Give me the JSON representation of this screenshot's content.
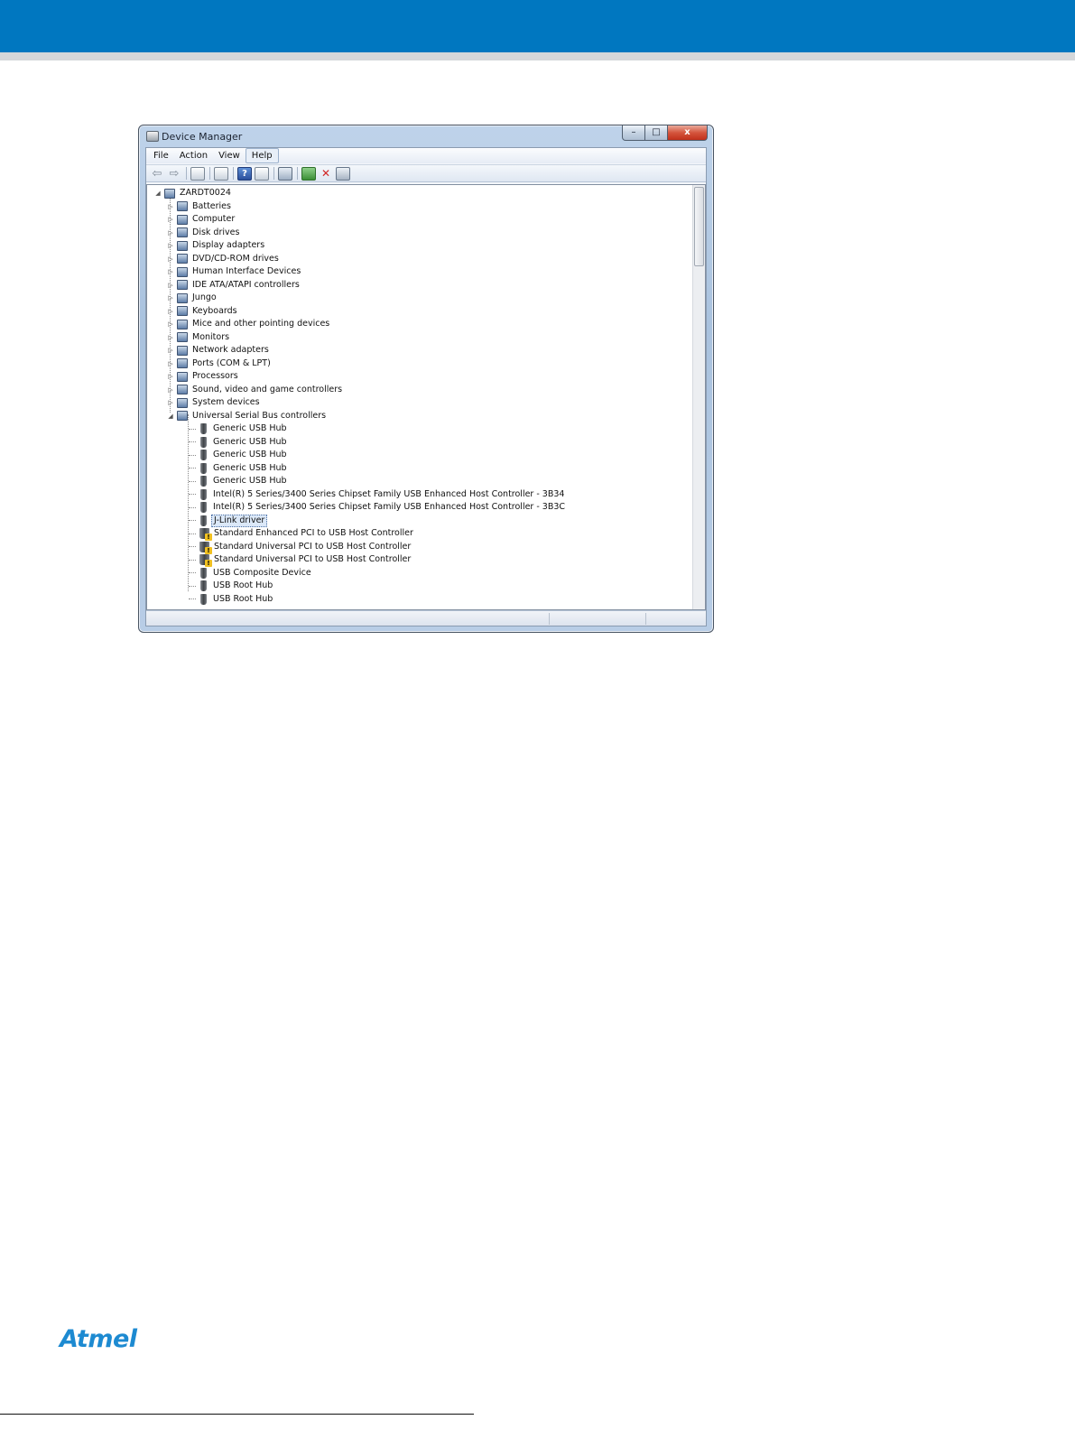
{
  "window": {
    "title": "Device Manager",
    "buttons": {
      "minimize": "–",
      "maximize": "□",
      "close": "x"
    }
  },
  "menu": [
    "File",
    "Action",
    "View",
    "Help"
  ],
  "toolbar": {
    "back": "⇦",
    "forward": "⇨",
    "help": "?",
    "remove": "✕"
  },
  "tree": {
    "root": "ZARDT0024",
    "categories": [
      "Batteries",
      "Computer",
      "Disk drives",
      "Display adapters",
      "DVD/CD-ROM drives",
      "Human Interface Devices",
      "IDE ATA/ATAPI controllers",
      "Jungo",
      "Keyboards",
      "Mice and other pointing devices",
      "Monitors",
      "Network adapters",
      "Ports (COM & LPT)",
      "Processors",
      "Sound, video and game controllers",
      "System devices",
      "Universal Serial Bus controllers"
    ],
    "usb_devices": [
      {
        "label": "Generic USB Hub",
        "warning": false
      },
      {
        "label": "Generic USB Hub",
        "warning": false
      },
      {
        "label": "Generic USB Hub",
        "warning": false
      },
      {
        "label": "Generic USB Hub",
        "warning": false
      },
      {
        "label": "Generic USB Hub",
        "warning": false
      },
      {
        "label": "Intel(R) 5 Series/3400 Series Chipset Family USB Enhanced Host Controller - 3B34",
        "warning": false
      },
      {
        "label": "Intel(R) 5 Series/3400 Series Chipset Family USB Enhanced Host Controller - 3B3C",
        "warning": false
      },
      {
        "label": "J-Link driver",
        "warning": false,
        "selected": true
      },
      {
        "label": "Standard Enhanced PCI to USB Host Controller",
        "warning": true
      },
      {
        "label": "Standard Universal PCI to USB Host Controller",
        "warning": true
      },
      {
        "label": "Standard Universal PCI to USB Host Controller",
        "warning": true
      },
      {
        "label": "USB Composite Device",
        "warning": false
      },
      {
        "label": "USB Root Hub",
        "warning": false
      },
      {
        "label": "USB Root Hub",
        "warning": false
      }
    ],
    "expander_collapsed": "▷",
    "expander_expanded": "◢"
  },
  "footer": {
    "logo": "Atmel"
  },
  "colors": {
    "header_band": "#0077c0",
    "logo": "#1d8ad1"
  }
}
